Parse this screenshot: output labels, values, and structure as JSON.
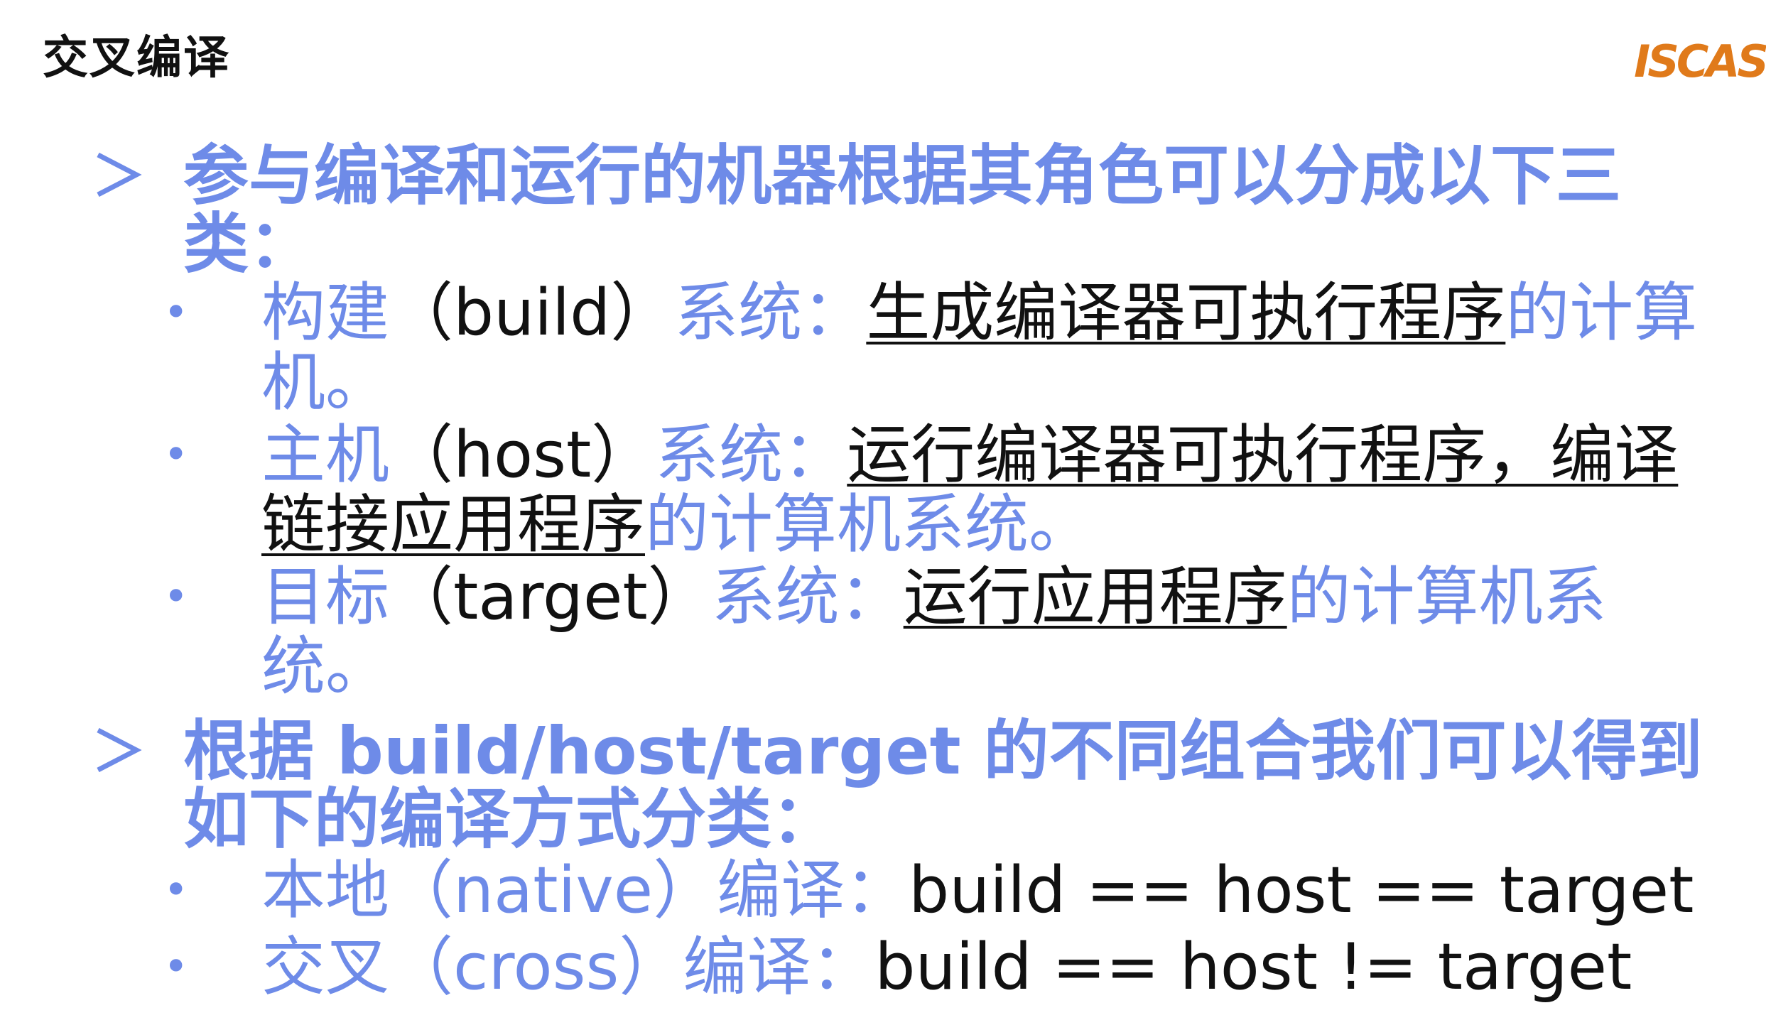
{
  "slide": {
    "title": "交叉编译",
    "logo_text": "ISCAS"
  },
  "sections": [
    {
      "heading": "参与编译和运行的机器根据其角色可以分成以下三类：",
      "items": [
        {
          "name": "构建",
          "term": "（build）",
          "role": "系统：",
          "underlined": "生成编译器可执行程序",
          "rest": "的计算机。"
        },
        {
          "name": "主机",
          "term": "（host）",
          "role": "系统：",
          "underlined": "运行编译器可执行程序，编译链接应用程序",
          "rest": "的计算机系统。"
        },
        {
          "name": "目标",
          "term": "（target）",
          "role": "系统：",
          "underlined": "运行应用程序",
          "rest": "的计算机系统。"
        }
      ]
    },
    {
      "heading": "根据 build/host/target 的不同组合我们可以得到如下的编译方式分类：",
      "items": [
        {
          "name": "本地",
          "term": "（native）",
          "role": "编译：",
          "expr": "build == host == target"
        },
        {
          "name": "交叉",
          "term": "（cross）",
          "role": "编译：",
          "expr": "build == host != target"
        }
      ]
    }
  ],
  "colors": {
    "accent": "#6e8be8",
    "text": "#111111",
    "logo": "#e07a1a"
  },
  "icons": {
    "level1_marker": "arrow-bullet-icon",
    "level2_marker": "dot-bullet-icon"
  }
}
